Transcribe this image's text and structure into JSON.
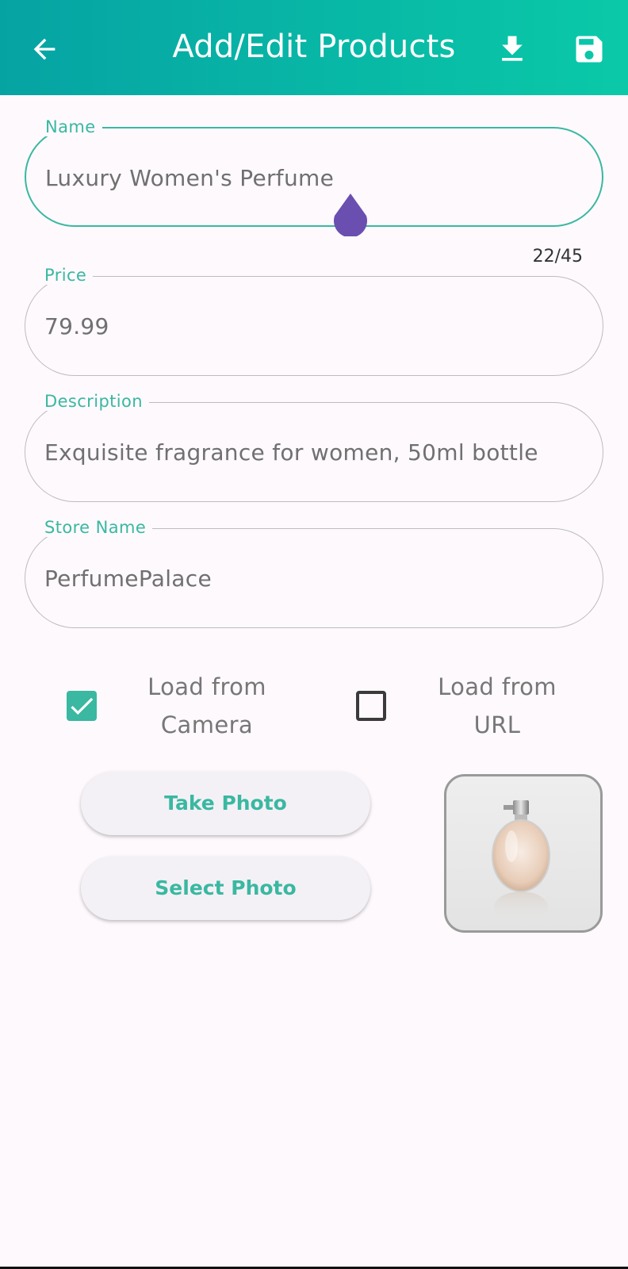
{
  "appbar": {
    "title": "Add/Edit Products",
    "back_icon": "arrow-back-icon",
    "download_icon": "download-icon",
    "save_icon": "save-icon",
    "accent_start": "#06a3a3",
    "accent_end": "#0ac9a8"
  },
  "form": {
    "name": {
      "label": "Name",
      "value": "Luxury Women's Perfume",
      "counter": "22/45"
    },
    "price": {
      "label": "Price",
      "value": "79.99"
    },
    "description": {
      "label": "Description",
      "value": "Exquisite fragrance for women, 50ml bottle"
    },
    "store": {
      "label": "Store Name",
      "value": "PerfumePalace"
    }
  },
  "options": {
    "camera": {
      "label_line1": "Load from",
      "label_line2": "Camera",
      "checked": true
    },
    "url": {
      "label_line1": "Load from",
      "label_line2": "URL",
      "checked": false
    }
  },
  "buttons": {
    "take_photo": "Take Photo",
    "select_photo": "Select Photo"
  },
  "colors": {
    "accent": "#3ab8a1",
    "cursor_handle": "#6a4fb0"
  }
}
